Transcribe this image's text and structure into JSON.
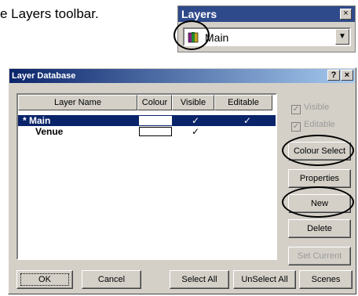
{
  "intro_text": "e Layers toolbar.",
  "toolbar": {
    "title": "Layers",
    "close_glyph": "×",
    "combo_value": "Main",
    "combo_arrow": "▼",
    "icon": "books-icon"
  },
  "dialog": {
    "title": "Layer Database",
    "help_glyph": "?",
    "close_glyph": "×",
    "columns": [
      "Layer Name",
      "Colour",
      "Visible",
      "Editable"
    ],
    "rows": [
      {
        "name": "* Main",
        "visible": "✓",
        "editable": "✓",
        "selected": true
      },
      {
        "name": "Venue",
        "visible": "✓",
        "editable": "",
        "selected": false
      }
    ],
    "checkboxes": {
      "visible": {
        "label": "Visible",
        "check": "✓"
      },
      "editable": {
        "label": "Editable",
        "check": "✓"
      }
    },
    "buttons": {
      "colour_select": "Colour Select",
      "properties": "Properties",
      "new": "New",
      "delete": "Delete",
      "set_current": "Set Current",
      "ok": "OK",
      "cancel": "Cancel",
      "select_all": "Select All",
      "unselect_all": "UnSelect All",
      "scenes": "Scenes"
    }
  }
}
